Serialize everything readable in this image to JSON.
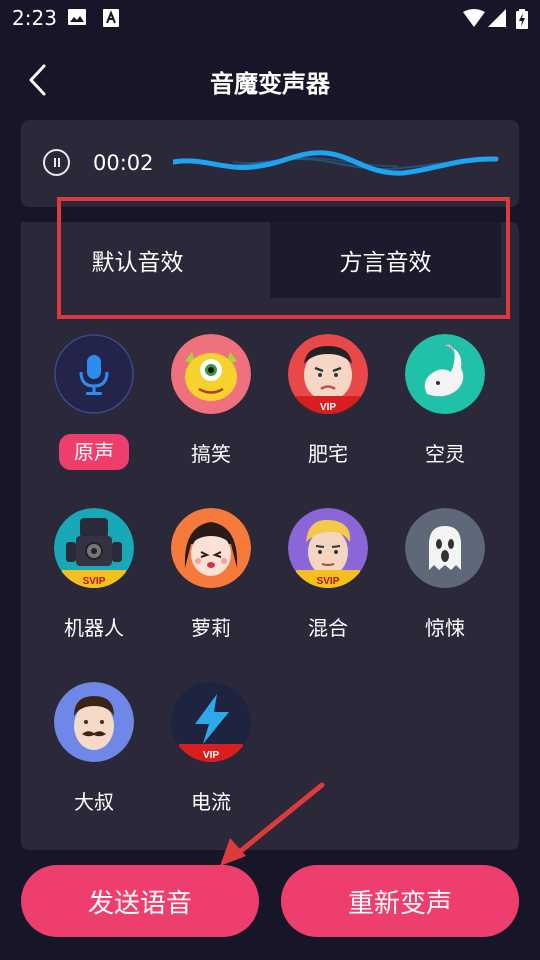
{
  "status_bar": {
    "time": "2:23"
  },
  "header": {
    "title": "音魔变声器"
  },
  "player": {
    "time": "00:02"
  },
  "tabs": [
    {
      "label": "默认音效"
    },
    {
      "label": "方言音效"
    }
  ],
  "effects": [
    {
      "label": "原声",
      "selected": true
    },
    {
      "label": "搞笑"
    },
    {
      "label": "肥宅",
      "badge": "VIP"
    },
    {
      "label": "空灵"
    },
    {
      "label": "机器人",
      "badge": "SVIP"
    },
    {
      "label": "萝莉"
    },
    {
      "label": "混合",
      "badge": "SVIP"
    },
    {
      "label": "惊悚"
    },
    {
      "label": "大叔"
    },
    {
      "label": "电流",
      "badge": "VIP"
    }
  ],
  "buttons": {
    "send": "发送语音",
    "redo": "重新变声"
  },
  "colors": {
    "accent": "#ee3e6e",
    "background": "#171528",
    "panel": "#2a2839",
    "highlight": "#dd3b3b",
    "wave": "#1ea4f0"
  }
}
